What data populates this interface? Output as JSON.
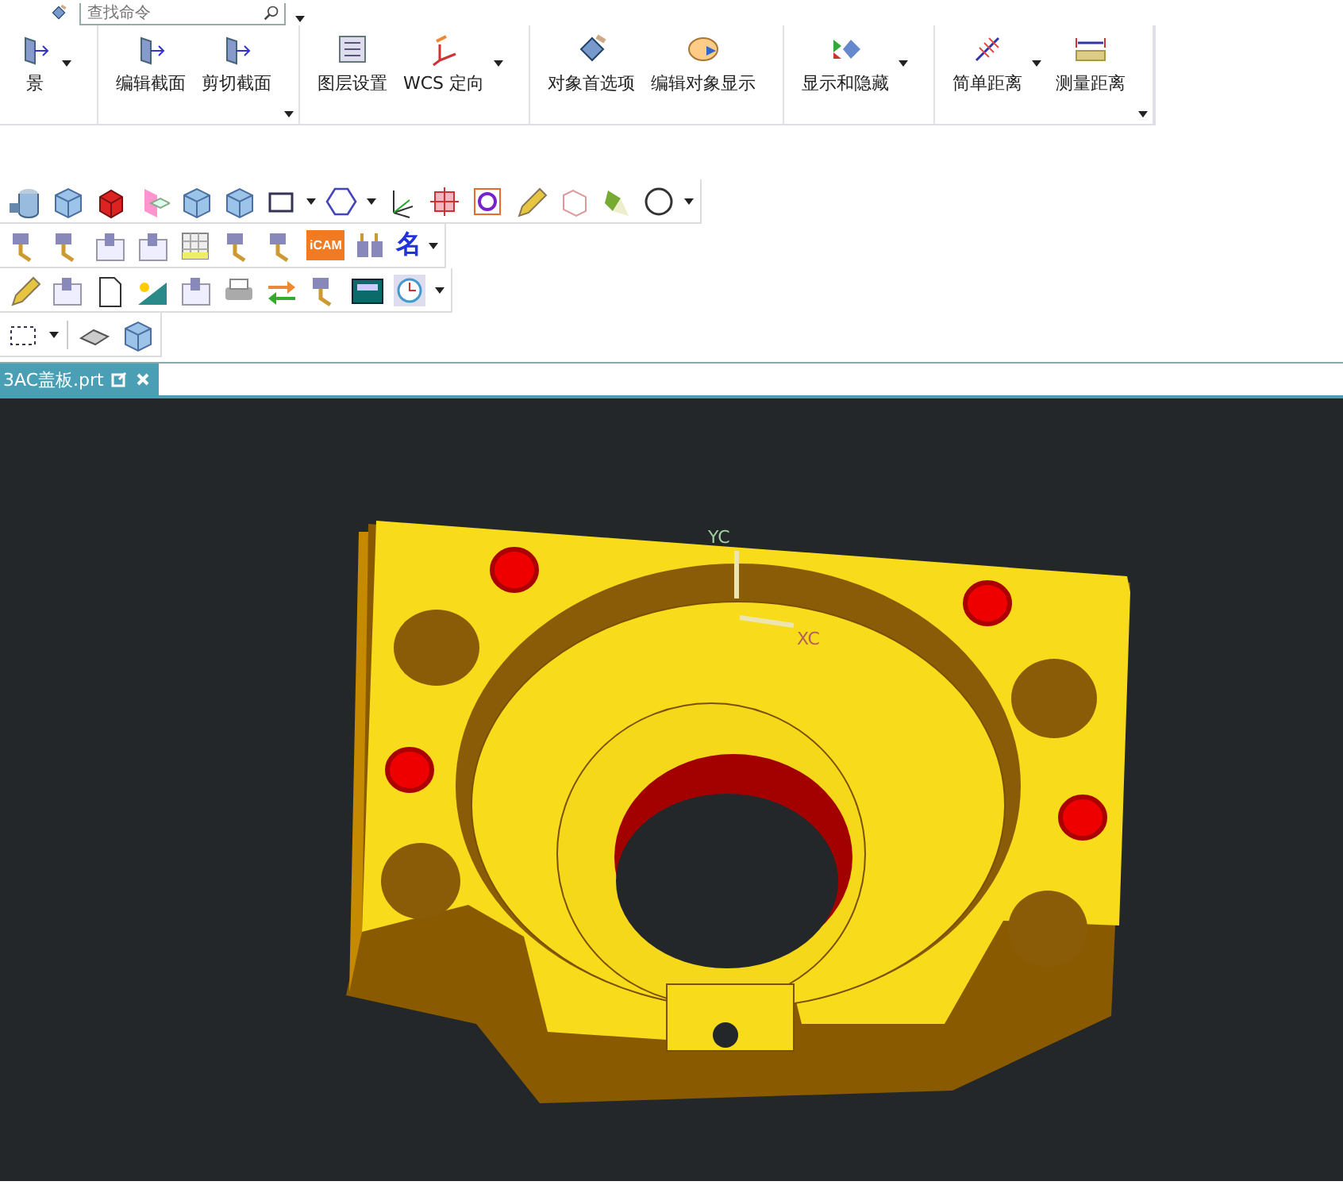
{
  "search": {
    "placeholder": "查找命令"
  },
  "ribbon": {
    "groups": [
      {
        "overflow": false,
        "buttons": [
          {
            "label": "景",
            "dropdown": true
          }
        ]
      },
      {
        "overflow": true,
        "buttons": [
          {
            "label": "编辑截面",
            "dropdown": false
          },
          {
            "label": "剪切截面",
            "dropdown": false
          }
        ]
      },
      {
        "overflow": false,
        "buttons": [
          {
            "label": "图层设置",
            "dropdown": false
          },
          {
            "label": "WCS 定向",
            "dropdown": true
          }
        ]
      },
      {
        "overflow": false,
        "buttons": [
          {
            "label": "对象首选项",
            "dropdown": false
          },
          {
            "label": "编辑对象显示",
            "dropdown": false
          }
        ]
      },
      {
        "overflow": false,
        "buttons": [
          {
            "label": "显示和隐藏",
            "dropdown": true
          }
        ]
      },
      {
        "overflow": true,
        "buttons": [
          {
            "label": "简单距离",
            "dropdown": true
          },
          {
            "label": "测量距离",
            "dropdown": false
          }
        ]
      }
    ]
  },
  "toolbar_texts": [
    {
      "label": "iCAM",
      "kind": "badge"
    },
    {
      "label": "名",
      "kind": "glyph"
    }
  ],
  "tabs": [
    {
      "label": "3AC盖板.prt",
      "selected": true
    }
  ],
  "viewport": {
    "triad": {
      "y_label": "YC",
      "x_label": "XC"
    }
  }
}
